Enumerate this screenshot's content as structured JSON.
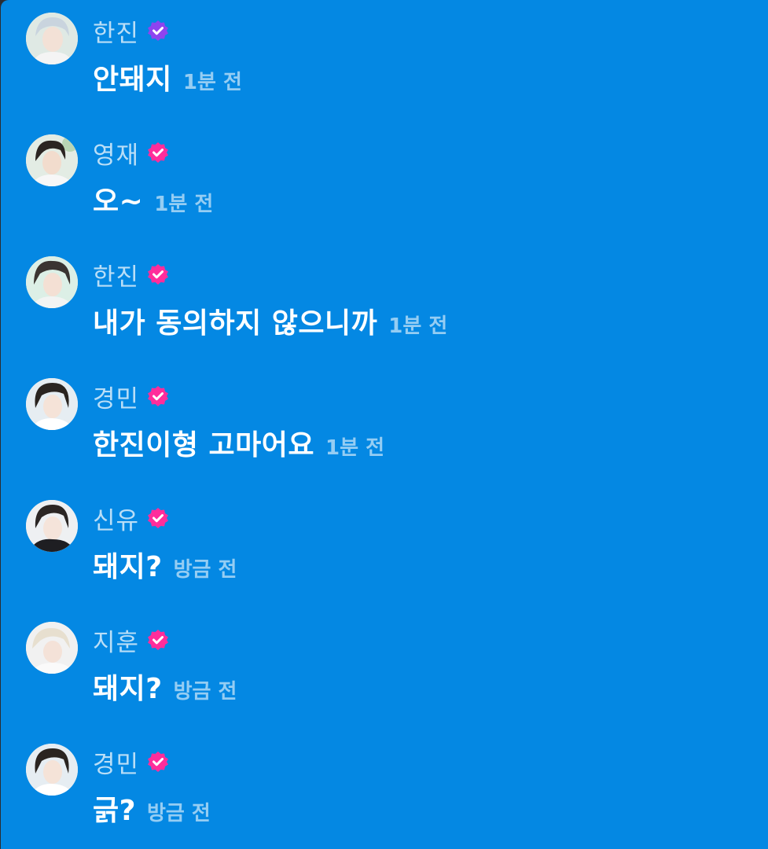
{
  "colors": {
    "background": "#0488e3",
    "badge_purple": "#8e44ef",
    "badge_pink": "#ff2d9b",
    "name_text": "#b7dcf7",
    "message_text": "#ffffff"
  },
  "messages": [
    {
      "name": "한진",
      "badge": "verified-badge-purple-icon",
      "text": "안돼지",
      "time": "1분 전"
    },
    {
      "name": "영재",
      "badge": "verified-badge-pink-icon",
      "text": "오~",
      "time": "1분 전"
    },
    {
      "name": "한진",
      "badge": "verified-badge-pink-icon",
      "text": "내가 동의하지 않으니까",
      "time": "1분 전"
    },
    {
      "name": "경민",
      "badge": "verified-badge-pink-icon",
      "text": "한진이형 고마어요",
      "time": "1분 전"
    },
    {
      "name": "신유",
      "badge": "verified-badge-pink-icon",
      "text": "돼지?",
      "time": "방금 전"
    },
    {
      "name": "지훈",
      "badge": "verified-badge-pink-icon",
      "text": "돼지?",
      "time": "방금 전"
    },
    {
      "name": "경민",
      "badge": "verified-badge-pink-icon",
      "text": "긁?",
      "time": "방금 전"
    }
  ]
}
